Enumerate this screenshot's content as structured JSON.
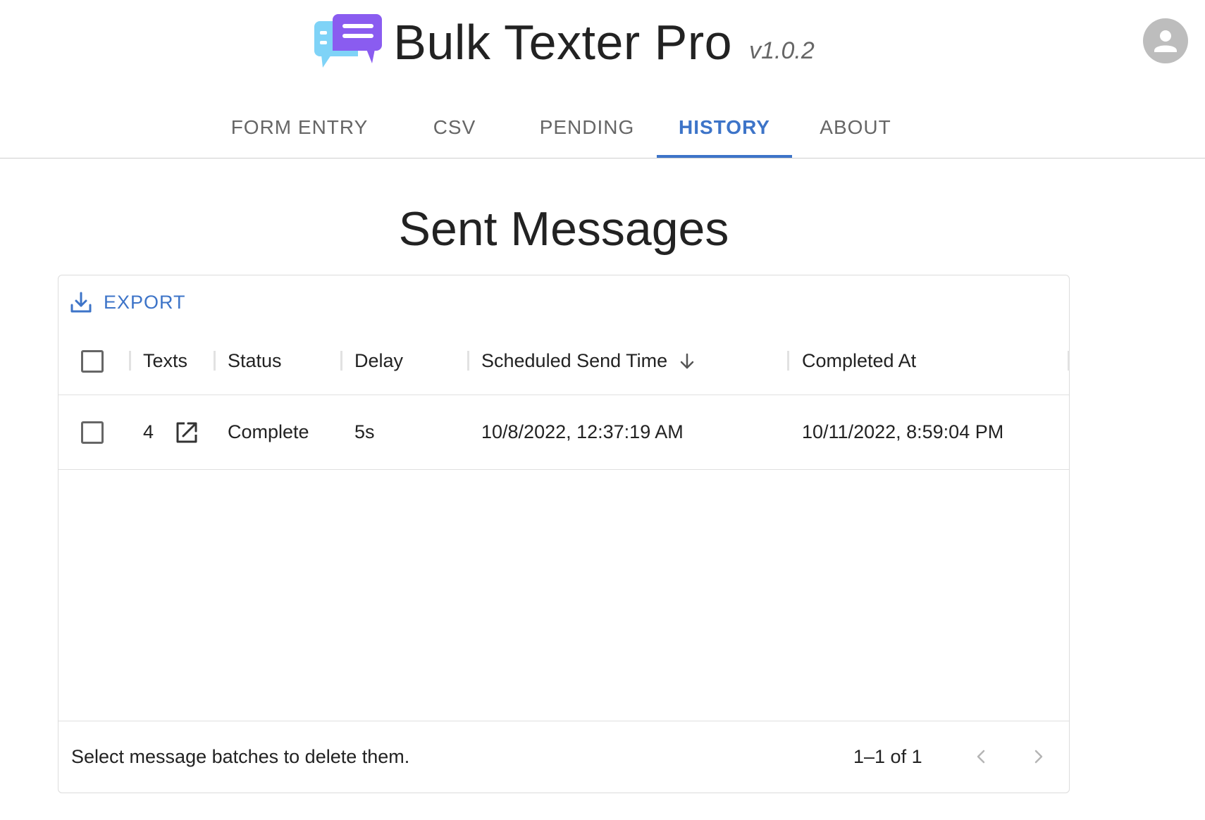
{
  "app": {
    "title": "Bulk Texter Pro",
    "version": "v1.0.2",
    "logo_icon": "chat-bubbles-logo",
    "avatar_icon": "account-circle-icon"
  },
  "tabs": [
    {
      "label": "FORM ENTRY",
      "active": false
    },
    {
      "label": "CSV",
      "active": false
    },
    {
      "label": "PENDING",
      "active": false
    },
    {
      "label": "HISTORY",
      "active": true
    },
    {
      "label": "ABOUT",
      "active": false
    }
  ],
  "page": {
    "heading": "Sent Messages"
  },
  "toolbar": {
    "export_label": "EXPORT",
    "export_icon": "download-icon"
  },
  "table": {
    "columns": [
      "Texts",
      "Status",
      "Delay",
      "Scheduled Send Time",
      "Completed At"
    ],
    "sort": {
      "column": "Scheduled Send Time",
      "direction": "descending"
    },
    "rows": [
      {
        "texts": "4",
        "status": "Complete",
        "delay": "5s",
        "scheduled_send_time": "10/8/2022, 12:37:19 AM",
        "completed_at": "10/11/2022, 8:59:04 PM",
        "selected": false
      }
    ]
  },
  "footer": {
    "hint": "Select message batches to delete them.",
    "pagination": "1–1 of 1"
  },
  "colors": {
    "accent": "#3d74c8",
    "logo_light": "#7fd3f7",
    "logo_purple": "#8a5cf0",
    "avatar_bg": "#bdbdbd"
  }
}
